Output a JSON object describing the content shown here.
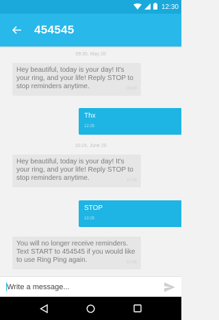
{
  "status_bar": {
    "time": "12:30",
    "icons": [
      "wifi-icon",
      "signal-icon",
      "battery-icon"
    ]
  },
  "app_bar": {
    "title": "454545",
    "back_icon": "arrow-left-icon"
  },
  "thread": {
    "messages": [
      {
        "type": "date",
        "text": "09:30, May 20"
      },
      {
        "type": "in",
        "text": "Hey beautiful, today is your day! It's your ring, and your life! Reply STOP to stop reminders anytime.",
        "time": "09:30"
      },
      {
        "type": "out",
        "text": "Thx",
        "time": "12:25"
      },
      {
        "type": "date",
        "text": "10:24, June 20"
      },
      {
        "type": "in",
        "text": "Hey beautiful, today is your day! It's your ring, and your life! Reply STOP to stop reminders anytime.",
        "time": "10:24"
      },
      {
        "type": "out",
        "text": "STOP",
        "time": "10:25"
      },
      {
        "type": "in",
        "text": "You will no longer receive reminders. Text START to 454545 if you would like to use Ring Ping again.",
        "time": "10:26"
      }
    ]
  },
  "composer": {
    "placeholder": "Write a message...",
    "value": "",
    "send_icon": "send-icon"
  },
  "nav_bar": {
    "icons": [
      "back-triangle-icon",
      "home-circle-icon",
      "recents-square-icon"
    ]
  },
  "colors": {
    "app_bar": "#28b8ea",
    "status_bar": "#1ba9db",
    "outgoing_bubble": "#1eb4e4",
    "incoming_bubble": "#e6e6e6"
  }
}
